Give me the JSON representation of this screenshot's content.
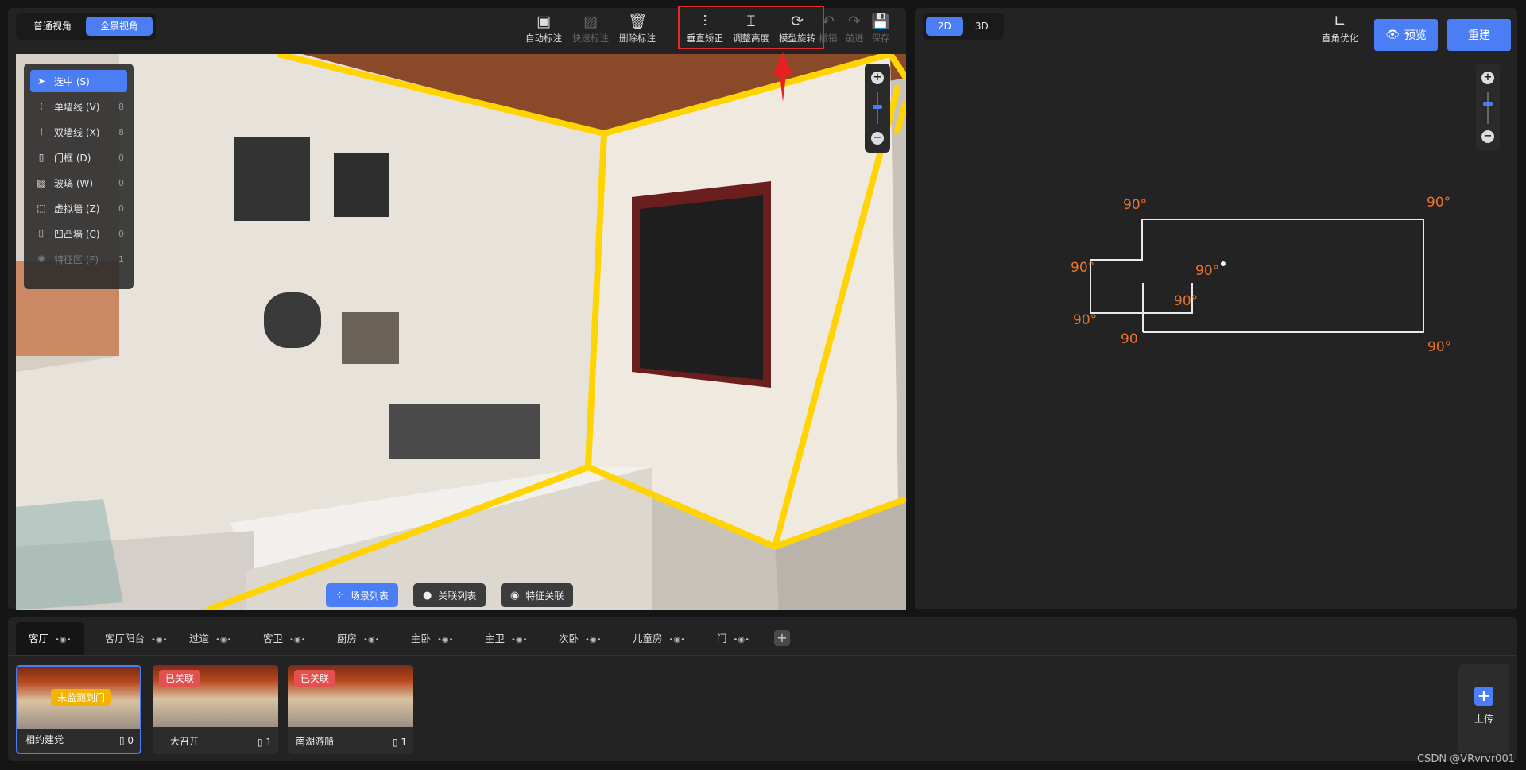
{
  "left_toolbar": {
    "view_modes": [
      "普通视角",
      "全景视角"
    ],
    "active_view": "全景视角",
    "tools": [
      {
        "label": "自动标注",
        "icon": "auto-annotate-icon"
      },
      {
        "label": "快速标注",
        "icon": "quick-annotate-icon"
      },
      {
        "label": "删除标注",
        "icon": "trash-icon"
      },
      {
        "label": "垂直矫正",
        "icon": "vertical-correct-icon"
      },
      {
        "label": "调整高度",
        "icon": "height-adjust-icon"
      },
      {
        "label": "模型旋转",
        "icon": "rotate-icon"
      },
      {
        "label": "撤销",
        "icon": "undo-icon"
      },
      {
        "label": "前进",
        "icon": "redo-icon"
      },
      {
        "label": "保存",
        "icon": "save-icon"
      }
    ]
  },
  "drawing_tools": [
    {
      "label": "选中 (S)",
      "count": ""
    },
    {
      "label": "单墙线 (V)",
      "count": "8"
    },
    {
      "label": "双墙线 (X)",
      "count": "8"
    },
    {
      "label": "门框 (D)",
      "count": "0"
    },
    {
      "label": "玻璃 (W)",
      "count": "0"
    },
    {
      "label": "虚拟墙 (Z)",
      "count": "0"
    },
    {
      "label": "凹凸墙 (C)",
      "count": "0"
    },
    {
      "label": "特征区 (F)",
      "count": "1"
    }
  ],
  "viewport_buttons": [
    "场景列表",
    "关联列表",
    "特征关联"
  ],
  "right_toolbar": {
    "modes": [
      "2D",
      "3D"
    ],
    "active_mode": "2D",
    "right_angle_label": "直角优化",
    "preview_label": "预览",
    "rebuild_label": "重建"
  },
  "floorplan": {
    "angles": [
      "90°",
      "90°",
      "90°",
      "90°",
      "90°",
      "90°",
      "90",
      "90°"
    ]
  },
  "zoom": {
    "in": "+",
    "out": "−"
  },
  "room_tabs": [
    "客厅",
    "客厅阳台",
    "过道",
    "客卫",
    "厨房",
    "主卧",
    "主卫",
    "次卧",
    "儿童房",
    "门"
  ],
  "active_room": "客厅",
  "scenes": [
    {
      "name": "相约建党",
      "count": "0",
      "tag": "未监测到门"
    },
    {
      "name": "一大召开",
      "count": "1",
      "tag": "已关联"
    },
    {
      "name": "南湖游船",
      "count": "1",
      "tag": "已关联"
    }
  ],
  "upload_label": "上传",
  "watermark": "CSDN @VRvrvr001",
  "colors": {
    "accent": "#4b7ef5",
    "highlight_box": "#e52b2b",
    "wall_line": "#ffd400",
    "angle_text": "#e8732e"
  }
}
